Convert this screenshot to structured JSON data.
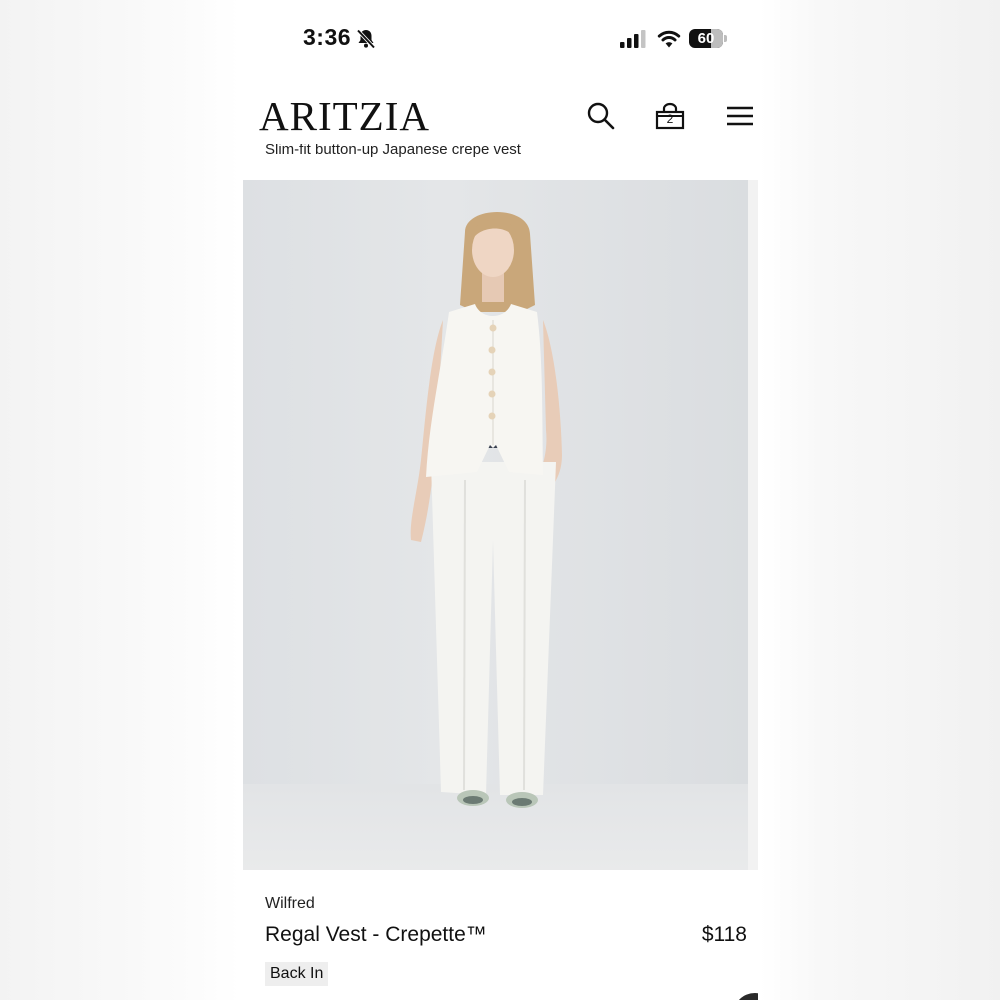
{
  "status_bar": {
    "time": "3:36",
    "battery": "60",
    "icons": [
      "bell-slash-icon",
      "cellular-signal-icon",
      "wifi-icon",
      "battery-icon"
    ]
  },
  "header": {
    "logo": "ARITZIA",
    "icons": [
      "search-icon",
      "shopping-bag-icon",
      "hamburger-menu-icon"
    ],
    "bag_count": "2"
  },
  "product": {
    "subtitle": "Slim-fit button-up Japanese crepe vest",
    "brand": "Wilfred",
    "name": "Regal Vest - Crepette™",
    "price": "$118",
    "badge": "Back In"
  },
  "colors": {
    "text": "#111111",
    "image_background": "#e2e4e6",
    "badge_background": "#eeeeee",
    "garment": "#f7f6f2"
  }
}
